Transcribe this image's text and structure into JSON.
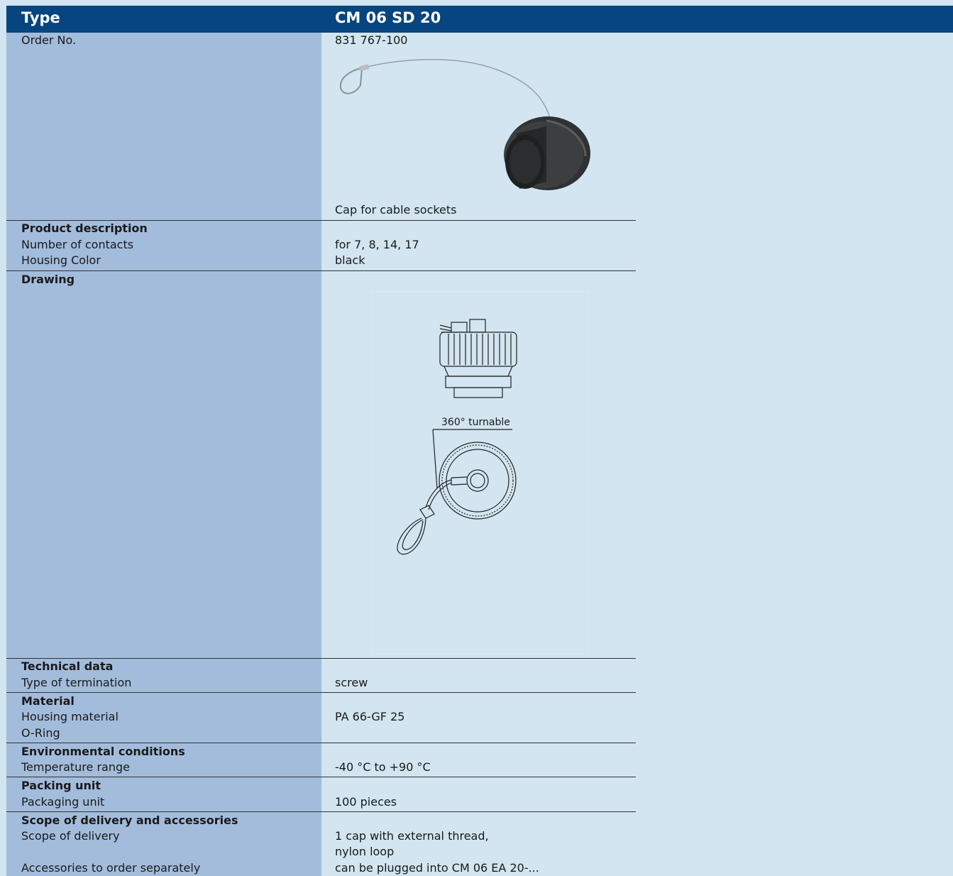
{
  "header": {
    "type_label": "Type",
    "type_value": "CM 06 SD 20"
  },
  "order": {
    "label": "Order No.",
    "value": "831 767-100"
  },
  "photo_caption": "Cap for cable sockets",
  "product_description": {
    "title": "Product description",
    "rows": [
      {
        "label": "Number of contacts",
        "value": "for 7, 8, 14, 17"
      },
      {
        "label": "Housing Color",
        "value": "black"
      }
    ]
  },
  "drawing": {
    "title": "Drawing",
    "annotation": "360° turnable"
  },
  "technical_data": {
    "title": "Technical data",
    "rows": [
      {
        "label": "Type of termination",
        "value": "screw"
      }
    ]
  },
  "material": {
    "title": "Material",
    "rows": [
      {
        "label": "Housing material",
        "value": "PA 66-GF 25"
      },
      {
        "label": "O-Ring",
        "value": ""
      }
    ]
  },
  "environmental": {
    "title": "Environmental conditions",
    "rows": [
      {
        "label": "Temperature range",
        "value": "-40 °C to +90 °C"
      }
    ]
  },
  "packing": {
    "title": "Packing unit",
    "rows": [
      {
        "label": "Packaging unit",
        "value": "100 pieces"
      }
    ]
  },
  "scope": {
    "title": "Scope of delivery and accessories",
    "delivery_label": "Scope of delivery",
    "delivery_value_1": "1 cap with external thread,",
    "delivery_value_2": "nylon loop",
    "accessories_label": "Accessories to order separately",
    "accessories_value": "can be plugged into CM 06 EA 20-..."
  },
  "colors": {
    "header_bg": "#06457f",
    "left_col": "#a3bcdb",
    "right_bg": "#d2e5f0"
  }
}
